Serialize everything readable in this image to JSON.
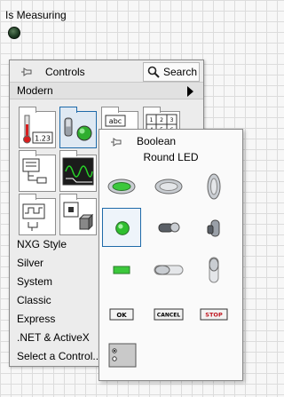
{
  "front_panel": {
    "indicator_label": "Is Measuring"
  },
  "controls_palette": {
    "title": "Controls",
    "search_label": "Search",
    "current_category": "Modern",
    "icons": [
      "numeric-icon",
      "boolean-icon",
      "string-path-icon",
      "array-matrix-icon",
      "list-table-tree-icon",
      "graph-icon",
      "io-icon",
      "container-icon"
    ],
    "categories": [
      "NXG Style",
      "Silver",
      "System",
      "Classic",
      "Express",
      ".NET & ActiveX",
      "Select a Control..."
    ],
    "thumbnail_texts": {
      "numeric": "1.23",
      "string": "abc"
    }
  },
  "boolean_palette": {
    "title": "Boolean",
    "hovered_item": "Round LED",
    "buttons": {
      "ok": "OK",
      "cancel": "CANCEL",
      "stop": "STOP"
    },
    "colors": {
      "led_green": "#3cc83c",
      "selection_border": "#1e6aa9",
      "stop_text": "#c0141e"
    }
  }
}
